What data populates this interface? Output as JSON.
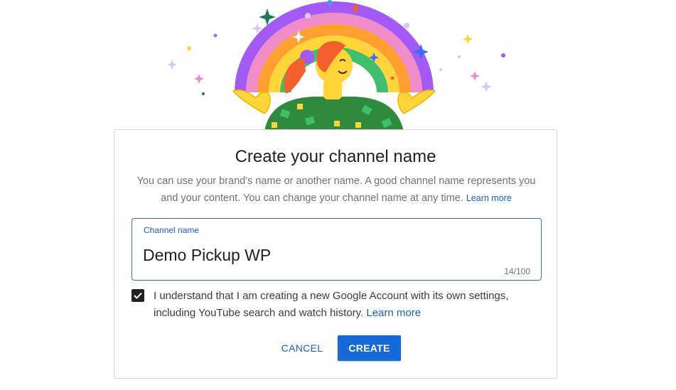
{
  "dialog": {
    "title": "Create your channel name",
    "description": "You can use your brand's name or another name. A good channel name represents you and your content. You can change your channel name at any time.",
    "description_link": "Learn more",
    "field": {
      "label": "Channel name",
      "value": "Demo Pickup WP",
      "counter": "14/100"
    },
    "consent": {
      "checked": true,
      "text": "I understand that I am creating a new Google Account with its own settings, including YouTube search and watch history.",
      "link": "Learn more"
    },
    "actions": {
      "cancel_label": "CANCEL",
      "create_label": "CREATE"
    }
  },
  "colors": {
    "accent": "#1769d6",
    "link": "#1a5fb4",
    "field_border": "#2a6fd6",
    "checkbox": "#212121"
  },
  "illustration": {
    "icon": "rainbow-person-illustration"
  }
}
